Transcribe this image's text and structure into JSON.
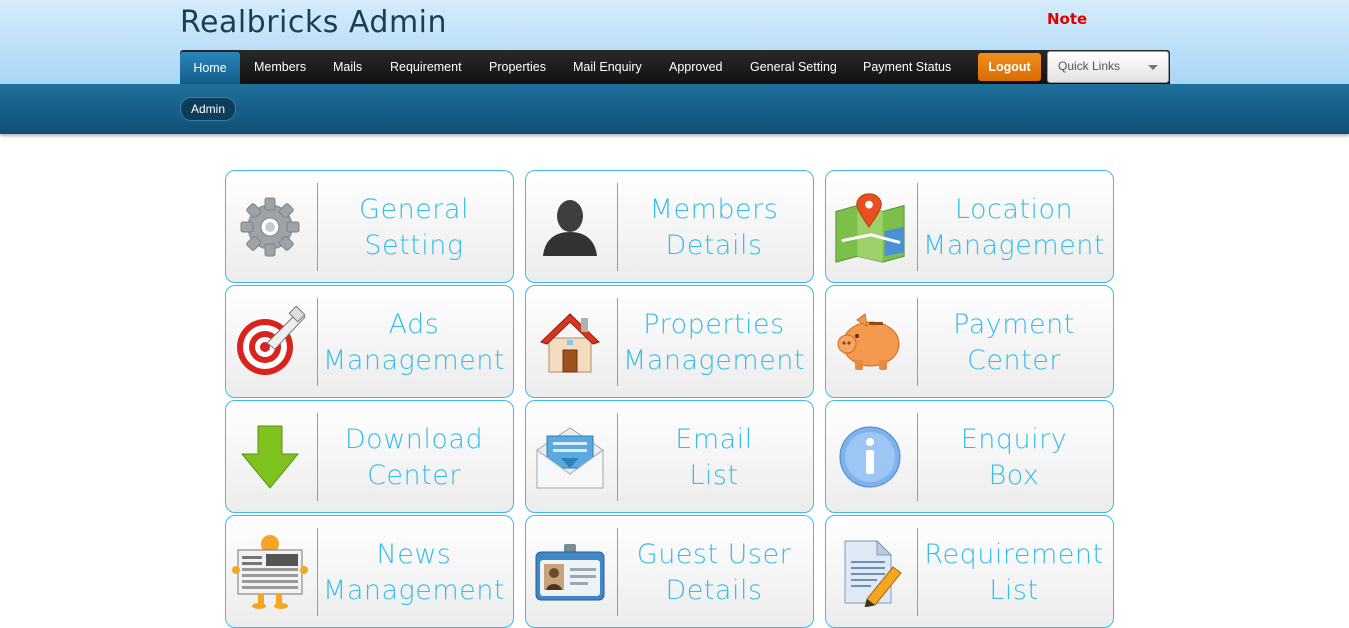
{
  "header": {
    "title": "Realbricks Admin",
    "note": "Note"
  },
  "nav": {
    "items": [
      "Home",
      "Members",
      "Mails",
      "Requirement",
      "Properties",
      "Mail Enquiry",
      "Approved",
      "General Setting",
      "Payment Status"
    ],
    "active": "Home",
    "logout_label": "Logout",
    "quick_links_label": "Quick Links"
  },
  "breadcrumb": {
    "label": "Admin"
  },
  "tiles": [
    {
      "line1": "General",
      "line2": "Setting",
      "icon": "gear-icon"
    },
    {
      "line1": "Members",
      "line2": "Details",
      "icon": "user-silhouette-icon"
    },
    {
      "line1": "Location",
      "line2": "Management",
      "icon": "map-pin-icon"
    },
    {
      "line1": "Ads",
      "line2": "Management",
      "icon": "target-icon"
    },
    {
      "line1": "Properties",
      "line2": "Management",
      "icon": "house-icon"
    },
    {
      "line1": "Payment",
      "line2": "Center",
      "icon": "piggy-bank-icon"
    },
    {
      "line1": "Download",
      "line2": "Center",
      "icon": "download-arrow-icon"
    },
    {
      "line1": "Email",
      "line2": "List",
      "icon": "envelope-icon"
    },
    {
      "line1": "Enquiry",
      "line2": "Box",
      "icon": "info-icon"
    },
    {
      "line1": "News",
      "line2": "Management",
      "icon": "newspaper-icon"
    },
    {
      "line1": "Guest User",
      "line2": "Details",
      "icon": "id-card-icon"
    },
    {
      "line1": "Requirement",
      "line2": "List",
      "icon": "document-pencil-icon"
    }
  ],
  "colors": {
    "accent": "#36bde6",
    "nav_active": "#1f6f9c",
    "logout": "#e27700",
    "note": "#e00000"
  }
}
